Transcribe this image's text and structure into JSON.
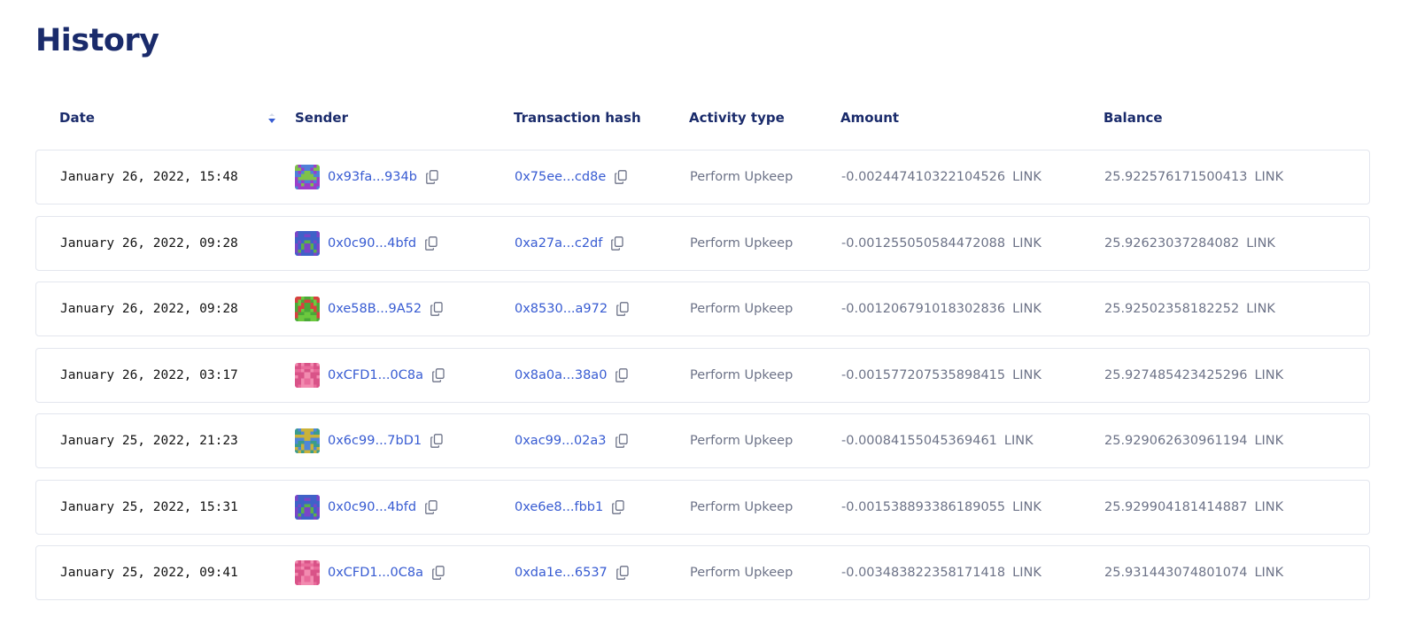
{
  "page": {
    "title": "History"
  },
  "table": {
    "columns": {
      "date": "Date",
      "sender": "Sender",
      "hash": "Transaction hash",
      "activity": "Activity type",
      "amount": "Amount",
      "balance": "Balance"
    },
    "sort": {
      "column": "Date",
      "direction": "descending",
      "icon": "sort-down-icon"
    },
    "rows": [
      {
        "date": "January 26, 2022, 15:48",
        "sender": "0x93fa...934b",
        "avatar_colors": [
          "#7fc24a",
          "#9b3ec9",
          "#4f7fd8"
        ],
        "hash": "0x75ee...cd8e",
        "activity": "Perform Upkeep",
        "amount": "-0.002447410322104526",
        "amount_unit": "LINK",
        "balance": "25.922576171500413",
        "balance_unit": "LINK"
      },
      {
        "date": "January 26, 2022, 09:28",
        "sender": "0x0c90...4bfd",
        "avatar_colors": [
          "#3f62c8",
          "#7a45c7",
          "#5bb04a"
        ],
        "hash": "0xa27a...c2df",
        "activity": "Perform Upkeep",
        "amount": "-0.001255050584472088",
        "amount_unit": "LINK",
        "balance": "25.92623037284082",
        "balance_unit": "LINK"
      },
      {
        "date": "January 26, 2022, 09:28",
        "sender": "0xe58B...9A52",
        "avatar_colors": [
          "#6cc93e",
          "#4aa838",
          "#d84040"
        ],
        "hash": "0x8530...a972",
        "activity": "Perform Upkeep",
        "amount": "-0.001206791018302836",
        "amount_unit": "LINK",
        "balance": "25.92502358182252",
        "balance_unit": "LINK"
      },
      {
        "date": "January 26, 2022, 03:17",
        "sender": "0xCFD1...0C8a",
        "avatar_colors": [
          "#e96b9b",
          "#d95388",
          "#f28bb0"
        ],
        "hash": "0x8a0a...38a0",
        "activity": "Perform Upkeep",
        "amount": "-0.001577207535898415",
        "amount_unit": "LINK",
        "balance": "25.927485423425296",
        "balance_unit": "LINK"
      },
      {
        "date": "January 25, 2022, 21:23",
        "sender": "0x6c99...7bD1",
        "avatar_colors": [
          "#4f86d8",
          "#c9b23a",
          "#3a9c8c"
        ],
        "hash": "0xac99...02a3",
        "activity": "Perform Upkeep",
        "amount": "-0.00084155045369461",
        "amount_unit": "LINK",
        "balance": "25.929062630961194",
        "balance_unit": "LINK"
      },
      {
        "date": "January 25, 2022, 15:31",
        "sender": "0x0c90...4bfd",
        "avatar_colors": [
          "#3f62c8",
          "#7a45c7",
          "#5bb04a"
        ],
        "hash": "0xe6e8...fbb1",
        "activity": "Perform Upkeep",
        "amount": "-0.001538893386189055",
        "amount_unit": "LINK",
        "balance": "25.929904181414887",
        "balance_unit": "LINK"
      },
      {
        "date": "January 25, 2022, 09:41",
        "sender": "0xCFD1...0C8a",
        "avatar_colors": [
          "#e96b9b",
          "#d95388",
          "#f28bb0"
        ],
        "hash": "0xda1e...6537",
        "activity": "Perform Upkeep",
        "amount": "-0.003483822358171418",
        "amount_unit": "LINK",
        "balance": "25.931443074801074",
        "balance_unit": "LINK"
      }
    ]
  },
  "colors": {
    "title": "#1a2b6b",
    "link": "#375bd2",
    "muted": "#6c7287",
    "row_border": "#e3e6ee"
  }
}
